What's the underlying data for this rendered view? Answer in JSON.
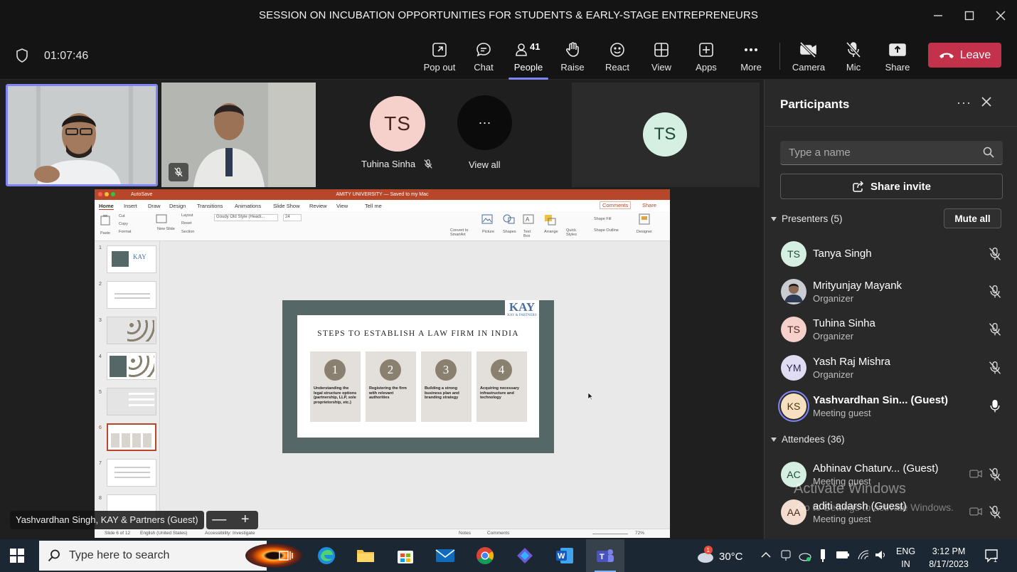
{
  "window": {
    "title": "SESSION ON INCUBATION OPPORTUNITIES FOR STUDENTS & EARLY-STAGE ENTREPRENEURS"
  },
  "meeting": {
    "timer": "01:07:46",
    "toolbar": [
      {
        "id": "popout",
        "label": "Pop out",
        "icon": "pop-out-icon"
      },
      {
        "id": "chat",
        "label": "Chat",
        "icon": "chat-icon"
      },
      {
        "id": "people",
        "label": "People",
        "icon": "people-icon",
        "count": "41",
        "active": true
      },
      {
        "id": "raise",
        "label": "Raise",
        "icon": "raise-hand-icon"
      },
      {
        "id": "react",
        "label": "React",
        "icon": "react-icon"
      },
      {
        "id": "view",
        "label": "View",
        "icon": "view-icon"
      },
      {
        "id": "apps",
        "label": "Apps",
        "icon": "apps-icon"
      },
      {
        "id": "more",
        "label": "More",
        "icon": "more-icon"
      },
      {
        "id": "camera",
        "label": "Camera",
        "icon": "camera-off-icon"
      },
      {
        "id": "mic",
        "label": "Mic",
        "icon": "mic-off-icon"
      },
      {
        "id": "share",
        "label": "Share",
        "icon": "share-icon"
      }
    ],
    "leave_label": "Leave",
    "leave_color": "#c4314b",
    "accent_color": "#7f85f5"
  },
  "gallery": {
    "tile3_initials": "TS",
    "tile3_name": "Tuhina Sinha",
    "view_all_label": "View all",
    "view_all_dots": "···",
    "tile5_initials": "TS"
  },
  "shared_screen": {
    "ppt_title": "AMITY UNIVERSITY — Saved to my Mac",
    "ppt_autosave": "AutoSave",
    "ppt_tabs": [
      "Home",
      "Insert",
      "Draw",
      "Design",
      "Transitions",
      "Animations",
      "Slide Show",
      "Review",
      "View",
      "Tell me"
    ],
    "ppt_comments": "Comments",
    "ppt_share": "Share",
    "ppt_font": "Goudy Old Style (Headi...",
    "ppt_size": "24",
    "ppt_ribbon": [
      "Paste",
      "Cut",
      "Copy",
      "Format",
      "New Slide",
      "Layout",
      "Reset",
      "Section",
      "Convert to SmartArt",
      "Picture",
      "Shapes",
      "Text Box",
      "Arrange",
      "Quick Styles",
      "Shape Fill",
      "Shape Outline",
      "Designer"
    ],
    "thumb_numbers": [
      "1",
      "2",
      "3",
      "4",
      "5",
      "6",
      "7",
      "8"
    ],
    "slide_title": "STEPS TO ESTABLISH A LAW FIRM IN INDIA",
    "slide_logo": "KAY",
    "slide_logo_sub": "KAY & PARTNERS",
    "steps": [
      {
        "num": "1",
        "text": "Understanding the legal structure options (partnership, LLP, sole proprietorship, etc.)"
      },
      {
        "num": "2",
        "text": "Registering the firm with relevant authorities"
      },
      {
        "num": "3",
        "text": "Building a strong business plan and branding strategy"
      },
      {
        "num": "4",
        "text": "Acquiring necessary infrastructure and technology"
      }
    ],
    "status_slide": "Slide 6 of 12",
    "status_lang": "English (United States)",
    "status_access": "Accessibility: Investigate",
    "status_notes": "Notes",
    "status_comments": "Comments",
    "status_zoom": "72%"
  },
  "caption": {
    "presenter": "Yashvardhan Singh, KAY & Partners (Guest)"
  },
  "zoom_controls": {
    "minus": "—",
    "plus": "+"
  },
  "panel": {
    "title": "Participants",
    "search_placeholder": "Type a name",
    "share_invite": "Share invite",
    "presenters_label": "Presenters (5)",
    "mute_all": "Mute all",
    "presenters": [
      {
        "initials": "TS",
        "name": "Tanya Singh",
        "role": "",
        "avatar_bg": "#d6efe3",
        "avatar_fg": "#1f4a3a",
        "mic": "mic-off-icon"
      },
      {
        "initials": "",
        "name": "Mrityunjay Mayank",
        "role": "Organizer",
        "avatar_bg": "#8c8c8c",
        "avatar_fg": "#fff",
        "mic": "mic-off-icon",
        "photo": true
      },
      {
        "initials": "TS",
        "name": "Tuhina Sinha",
        "role": "Organizer",
        "avatar_bg": "#f6d0cb",
        "avatar_fg": "#4a2320",
        "mic": "mic-off-icon"
      },
      {
        "initials": "YM",
        "name": "Yash Raj Mishra",
        "role": "Organizer",
        "avatar_bg": "#e0dcf2",
        "avatar_fg": "#2e2a55",
        "mic": "mic-off-icon"
      },
      {
        "initials": "KS",
        "name": "Yashvardhan Sin... (Guest)",
        "role": "Meeting guest",
        "avatar_bg": "#f6e0c0",
        "avatar_fg": "#4a3515",
        "mic": "mic-on-icon",
        "speaking": true
      }
    ],
    "attendees_label": "Attendees (36)",
    "attendees": [
      {
        "initials": "AC",
        "name": "Abhinav Chaturv... (Guest)",
        "role": "Meeting guest",
        "avatar_bg": "#d6efe3",
        "avatar_fg": "#1f4a3a"
      },
      {
        "initials": "AA",
        "name": "aditi adarsh (Guest)",
        "role": "Meeting guest",
        "avatar_bg": "#f4dccf",
        "avatar_fg": "#4a2a1a"
      }
    ],
    "watermark": "Activate Windows",
    "watermark_sub": "Go to Settings to activate Windows."
  },
  "taskbar": {
    "search_placeholder": "Type here to search",
    "apps": [
      "task-view-icon",
      "edge-icon",
      "file-explorer-icon",
      "store-icon",
      "mail-icon",
      "chrome-icon",
      "copilot-icon",
      "word-icon",
      "teams-icon"
    ],
    "weather_badge": "1",
    "temperature": "30°C",
    "lang_top": "ENG",
    "lang_bottom": "IN",
    "time": "3:12 PM",
    "date": "8/17/2023",
    "notif_count": "1"
  }
}
